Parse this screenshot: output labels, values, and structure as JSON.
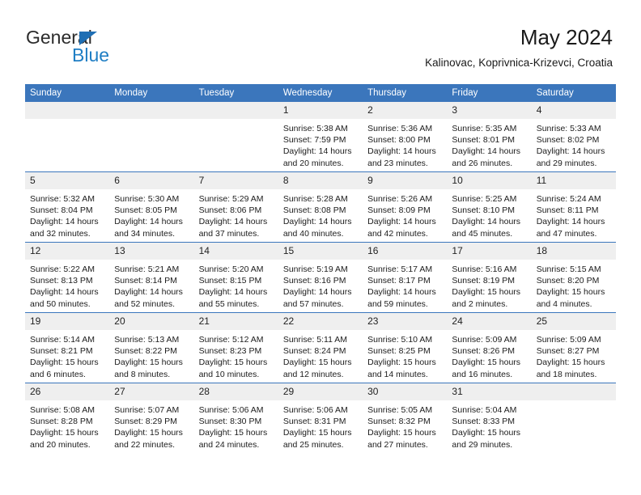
{
  "brand": {
    "name_part1": "General",
    "name_part2": "Blue",
    "triangle_color": "#1f6fb4",
    "blue_color": "#1f7ec4"
  },
  "header": {
    "title": "May 2024",
    "subtitle": "Kalinovac, Koprivnica-Krizevci, Croatia"
  },
  "theme": {
    "header_bg": "#3b76bc",
    "daynum_bg": "#efefef",
    "row_rule": "#3b76bc"
  },
  "weekdays": [
    "Sunday",
    "Monday",
    "Tuesday",
    "Wednesday",
    "Thursday",
    "Friday",
    "Saturday"
  ],
  "labels": {
    "sunrise": "Sunrise:",
    "sunset": "Sunset:",
    "daylight": "Daylight:"
  },
  "weeks": [
    [
      {
        "day": "",
        "blank": true
      },
      {
        "day": "",
        "blank": true
      },
      {
        "day": "",
        "blank": true
      },
      {
        "day": "1",
        "sunrise": "Sunrise: 5:38 AM",
        "sunset": "Sunset: 7:59 PM",
        "daylight_l1": "Daylight: 14 hours",
        "daylight_l2": "and 20 minutes."
      },
      {
        "day": "2",
        "sunrise": "Sunrise: 5:36 AM",
        "sunset": "Sunset: 8:00 PM",
        "daylight_l1": "Daylight: 14 hours",
        "daylight_l2": "and 23 minutes."
      },
      {
        "day": "3",
        "sunrise": "Sunrise: 5:35 AM",
        "sunset": "Sunset: 8:01 PM",
        "daylight_l1": "Daylight: 14 hours",
        "daylight_l2": "and 26 minutes."
      },
      {
        "day": "4",
        "sunrise": "Sunrise: 5:33 AM",
        "sunset": "Sunset: 8:02 PM",
        "daylight_l1": "Daylight: 14 hours",
        "daylight_l2": "and 29 minutes."
      }
    ],
    [
      {
        "day": "5",
        "sunrise": "Sunrise: 5:32 AM",
        "sunset": "Sunset: 8:04 PM",
        "daylight_l1": "Daylight: 14 hours",
        "daylight_l2": "and 32 minutes."
      },
      {
        "day": "6",
        "sunrise": "Sunrise: 5:30 AM",
        "sunset": "Sunset: 8:05 PM",
        "daylight_l1": "Daylight: 14 hours",
        "daylight_l2": "and 34 minutes."
      },
      {
        "day": "7",
        "sunrise": "Sunrise: 5:29 AM",
        "sunset": "Sunset: 8:06 PM",
        "daylight_l1": "Daylight: 14 hours",
        "daylight_l2": "and 37 minutes."
      },
      {
        "day": "8",
        "sunrise": "Sunrise: 5:28 AM",
        "sunset": "Sunset: 8:08 PM",
        "daylight_l1": "Daylight: 14 hours",
        "daylight_l2": "and 40 minutes."
      },
      {
        "day": "9",
        "sunrise": "Sunrise: 5:26 AM",
        "sunset": "Sunset: 8:09 PM",
        "daylight_l1": "Daylight: 14 hours",
        "daylight_l2": "and 42 minutes."
      },
      {
        "day": "10",
        "sunrise": "Sunrise: 5:25 AM",
        "sunset": "Sunset: 8:10 PM",
        "daylight_l1": "Daylight: 14 hours",
        "daylight_l2": "and 45 minutes."
      },
      {
        "day": "11",
        "sunrise": "Sunrise: 5:24 AM",
        "sunset": "Sunset: 8:11 PM",
        "daylight_l1": "Daylight: 14 hours",
        "daylight_l2": "and 47 minutes."
      }
    ],
    [
      {
        "day": "12",
        "sunrise": "Sunrise: 5:22 AM",
        "sunset": "Sunset: 8:13 PM",
        "daylight_l1": "Daylight: 14 hours",
        "daylight_l2": "and 50 minutes."
      },
      {
        "day": "13",
        "sunrise": "Sunrise: 5:21 AM",
        "sunset": "Sunset: 8:14 PM",
        "daylight_l1": "Daylight: 14 hours",
        "daylight_l2": "and 52 minutes."
      },
      {
        "day": "14",
        "sunrise": "Sunrise: 5:20 AM",
        "sunset": "Sunset: 8:15 PM",
        "daylight_l1": "Daylight: 14 hours",
        "daylight_l2": "and 55 minutes."
      },
      {
        "day": "15",
        "sunrise": "Sunrise: 5:19 AM",
        "sunset": "Sunset: 8:16 PM",
        "daylight_l1": "Daylight: 14 hours",
        "daylight_l2": "and 57 minutes."
      },
      {
        "day": "16",
        "sunrise": "Sunrise: 5:17 AM",
        "sunset": "Sunset: 8:17 PM",
        "daylight_l1": "Daylight: 14 hours",
        "daylight_l2": "and 59 minutes."
      },
      {
        "day": "17",
        "sunrise": "Sunrise: 5:16 AM",
        "sunset": "Sunset: 8:19 PM",
        "daylight_l1": "Daylight: 15 hours",
        "daylight_l2": "and 2 minutes."
      },
      {
        "day": "18",
        "sunrise": "Sunrise: 5:15 AM",
        "sunset": "Sunset: 8:20 PM",
        "daylight_l1": "Daylight: 15 hours",
        "daylight_l2": "and 4 minutes."
      }
    ],
    [
      {
        "day": "19",
        "sunrise": "Sunrise: 5:14 AM",
        "sunset": "Sunset: 8:21 PM",
        "daylight_l1": "Daylight: 15 hours",
        "daylight_l2": "and 6 minutes."
      },
      {
        "day": "20",
        "sunrise": "Sunrise: 5:13 AM",
        "sunset": "Sunset: 8:22 PM",
        "daylight_l1": "Daylight: 15 hours",
        "daylight_l2": "and 8 minutes."
      },
      {
        "day": "21",
        "sunrise": "Sunrise: 5:12 AM",
        "sunset": "Sunset: 8:23 PM",
        "daylight_l1": "Daylight: 15 hours",
        "daylight_l2": "and 10 minutes."
      },
      {
        "day": "22",
        "sunrise": "Sunrise: 5:11 AM",
        "sunset": "Sunset: 8:24 PM",
        "daylight_l1": "Daylight: 15 hours",
        "daylight_l2": "and 12 minutes."
      },
      {
        "day": "23",
        "sunrise": "Sunrise: 5:10 AM",
        "sunset": "Sunset: 8:25 PM",
        "daylight_l1": "Daylight: 15 hours",
        "daylight_l2": "and 14 minutes."
      },
      {
        "day": "24",
        "sunrise": "Sunrise: 5:09 AM",
        "sunset": "Sunset: 8:26 PM",
        "daylight_l1": "Daylight: 15 hours",
        "daylight_l2": "and 16 minutes."
      },
      {
        "day": "25",
        "sunrise": "Sunrise: 5:09 AM",
        "sunset": "Sunset: 8:27 PM",
        "daylight_l1": "Daylight: 15 hours",
        "daylight_l2": "and 18 minutes."
      }
    ],
    [
      {
        "day": "26",
        "sunrise": "Sunrise: 5:08 AM",
        "sunset": "Sunset: 8:28 PM",
        "daylight_l1": "Daylight: 15 hours",
        "daylight_l2": "and 20 minutes."
      },
      {
        "day": "27",
        "sunrise": "Sunrise: 5:07 AM",
        "sunset": "Sunset: 8:29 PM",
        "daylight_l1": "Daylight: 15 hours",
        "daylight_l2": "and 22 minutes."
      },
      {
        "day": "28",
        "sunrise": "Sunrise: 5:06 AM",
        "sunset": "Sunset: 8:30 PM",
        "daylight_l1": "Daylight: 15 hours",
        "daylight_l2": "and 24 minutes."
      },
      {
        "day": "29",
        "sunrise": "Sunrise: 5:06 AM",
        "sunset": "Sunset: 8:31 PM",
        "daylight_l1": "Daylight: 15 hours",
        "daylight_l2": "and 25 minutes."
      },
      {
        "day": "30",
        "sunrise": "Sunrise: 5:05 AM",
        "sunset": "Sunset: 8:32 PM",
        "daylight_l1": "Daylight: 15 hours",
        "daylight_l2": "and 27 minutes."
      },
      {
        "day": "31",
        "sunrise": "Sunrise: 5:04 AM",
        "sunset": "Sunset: 8:33 PM",
        "daylight_l1": "Daylight: 15 hours",
        "daylight_l2": "and 29 minutes."
      },
      {
        "day": "",
        "blank": true
      }
    ]
  ]
}
